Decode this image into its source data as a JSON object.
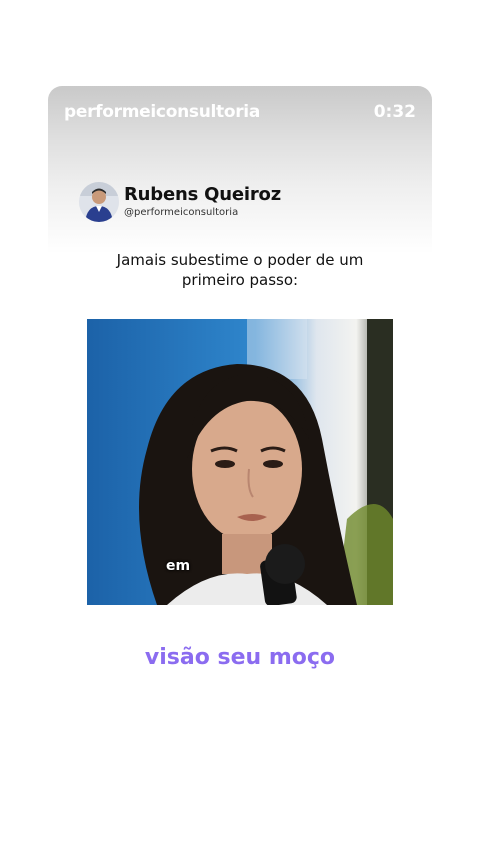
{
  "header": {
    "account": "performeiconsultoria",
    "timer": "0:32"
  },
  "author": {
    "name": "Rubens Queiroz",
    "handle": "@performeiconsultoria"
  },
  "post": {
    "caption": "Jamais subestime o poder de um primeiro passo:"
  },
  "video": {
    "subtitle": "em"
  },
  "story_text": "visão seu moço",
  "colors": {
    "overlay_text": "#8b6cf0",
    "video_bg": "#1e6fb3"
  }
}
